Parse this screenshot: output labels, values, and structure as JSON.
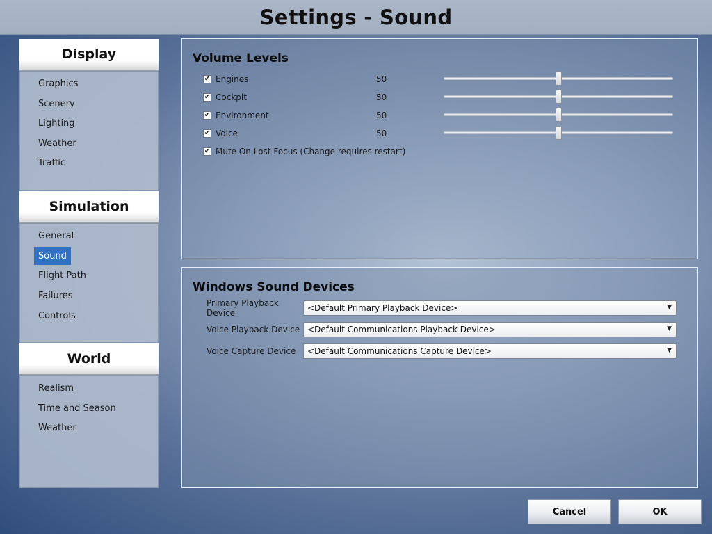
{
  "window": {
    "title": "Settings - Sound"
  },
  "sidebar": {
    "categories": [
      {
        "header": "Display",
        "items": [
          "Graphics",
          "Scenery",
          "Lighting",
          "Weather",
          "Traffic"
        ]
      },
      {
        "header": "Simulation",
        "items": [
          "General",
          "Sound",
          "Flight Path",
          "Failures",
          "Controls"
        ],
        "active": "Sound"
      },
      {
        "header": "World",
        "items": [
          "Realism",
          "Time and Season",
          "Weather"
        ]
      }
    ]
  },
  "volume": {
    "title": "Volume Levels",
    "rows": [
      {
        "label": "Engines",
        "value": "50",
        "checked": true,
        "level": 50,
        "max": 100
      },
      {
        "label": "Cockpit",
        "value": "50",
        "checked": true,
        "level": 50,
        "max": 100
      },
      {
        "label": "Environment",
        "value": "50",
        "checked": true,
        "level": 50,
        "max": 100
      },
      {
        "label": "Voice",
        "value": "50",
        "checked": true,
        "level": 50,
        "max": 100
      }
    ],
    "mute": {
      "label": "Mute On Lost Focus (Change requires restart)",
      "checked": true
    }
  },
  "devices": {
    "title": "Windows Sound Devices",
    "rows": [
      {
        "label": "Primary Playback Device",
        "value": "<Default Primary Playback Device>"
      },
      {
        "label": "Voice Playback Device",
        "value": "<Default Communications Playback Device>"
      },
      {
        "label": "Voice Capture Device",
        "value": "<Default Communications Capture Device>"
      }
    ]
  },
  "footer": {
    "cancel_label": "Cancel",
    "ok_label": "OK"
  },
  "icons": {
    "check": "check-icon",
    "dropdown": "chevron-down-icon"
  },
  "colors": {
    "selected": "#2f72c4",
    "panel_border": "#e9eef5"
  }
}
